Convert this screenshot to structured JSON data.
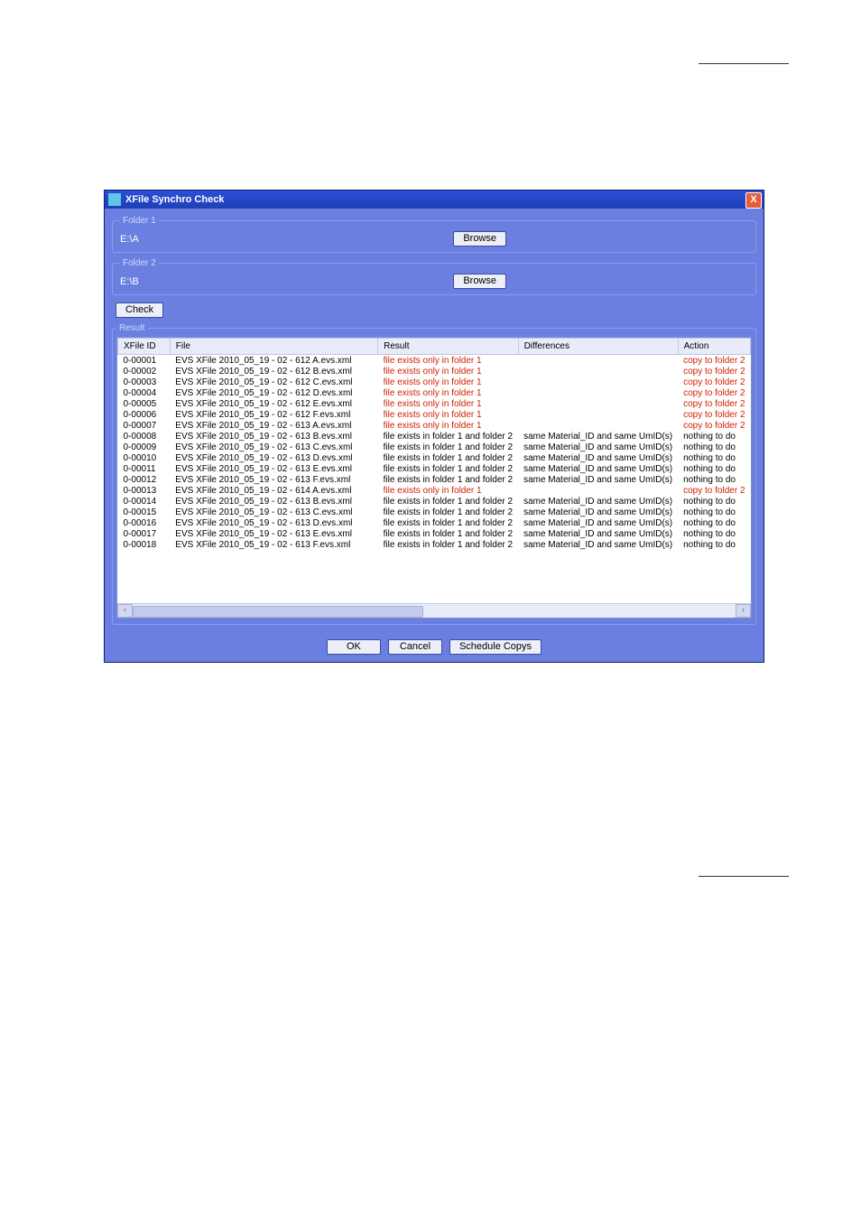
{
  "window": {
    "title": "XFile Synchro Check",
    "close": "X"
  },
  "folder1": {
    "legend": "Folder 1",
    "path": "E:\\A",
    "browse": "Browse"
  },
  "folder2": {
    "legend": "Folder 2",
    "path": "E:\\B",
    "browse": "Browse"
  },
  "check_btn": "Check",
  "result_legend": "Result",
  "columns": {
    "xfileid": "XFile ID",
    "file": "File",
    "result": "Result",
    "differences": "Differences",
    "action": "Action"
  },
  "rows": [
    {
      "id": "0-00001",
      "file": "EVS XFile 2010_05_19 - 02 - 612 A.evs.xml",
      "result": "file exists only in folder 1",
      "diff": "",
      "action": "copy to folder 2",
      "red": true
    },
    {
      "id": "0-00002",
      "file": "EVS XFile 2010_05_19 - 02 - 612 B.evs.xml",
      "result": "file exists only in folder 1",
      "diff": "",
      "action": "copy to folder 2",
      "red": true
    },
    {
      "id": "0-00003",
      "file": "EVS XFile 2010_05_19 - 02 - 612 C.evs.xml",
      "result": "file exists only in folder 1",
      "diff": "",
      "action": "copy to folder 2",
      "red": true
    },
    {
      "id": "0-00004",
      "file": "EVS XFile 2010_05_19 - 02 - 612 D.evs.xml",
      "result": "file exists only in folder 1",
      "diff": "",
      "action": "copy to folder 2",
      "red": true
    },
    {
      "id": "0-00005",
      "file": "EVS XFile 2010_05_19 - 02 - 612 E.evs.xml",
      "result": "file exists only in folder 1",
      "diff": "",
      "action": "copy to folder 2",
      "red": true
    },
    {
      "id": "0-00006",
      "file": "EVS XFile 2010_05_19 - 02 - 612 F.evs.xml",
      "result": "file exists only in folder 1",
      "diff": "",
      "action": "copy to folder 2",
      "red": true
    },
    {
      "id": "0-00007",
      "file": "EVS XFile 2010_05_19 - 02 - 613 A.evs.xml",
      "result": "file exists only in folder 1",
      "diff": "",
      "action": "copy to folder 2",
      "red": true
    },
    {
      "id": "0-00008",
      "file": "EVS XFile 2010_05_19 - 02 - 613 B.evs.xml",
      "result": "file exists in folder 1 and folder 2",
      "diff": "same Material_ID and same UmID(s)",
      "action": "nothing to do",
      "red": false
    },
    {
      "id": "0-00009",
      "file": "EVS XFile 2010_05_19 - 02 - 613 C.evs.xml",
      "result": "file exists in folder 1 and folder 2",
      "diff": "same Material_ID and same UmID(s)",
      "action": "nothing to do",
      "red": false
    },
    {
      "id": "0-00010",
      "file": "EVS XFile 2010_05_19 - 02 - 613 D.evs.xml",
      "result": "file exists in folder 1 and folder 2",
      "diff": "same Material_ID and same UmID(s)",
      "action": "nothing to do",
      "red": false
    },
    {
      "id": "0-00011",
      "file": "EVS XFile 2010_05_19 - 02 - 613 E.evs.xml",
      "result": "file exists in folder 1 and folder 2",
      "diff": "same Material_ID and same UmID(s)",
      "action": "nothing to do",
      "red": false
    },
    {
      "id": "0-00012",
      "file": "EVS XFile 2010_05_19 - 02 - 613 F.evs.xml",
      "result": "file exists in folder 1 and folder 2",
      "diff": "same Material_ID and same UmID(s)",
      "action": "nothing to do",
      "red": false
    },
    {
      "id": "0-00013",
      "file": "EVS XFile 2010_05_19 - 02 - 614 A.evs.xml",
      "result": "file exists only in folder 1",
      "diff": "",
      "action": "copy to folder 2",
      "red": true
    },
    {
      "id": "0-00014",
      "file": "EVS XFile 2010_05_19 - 02 - 613 B.evs.xml",
      "result": "file exists in folder 1 and folder 2",
      "diff": "same Material_ID and same UmID(s)",
      "action": "nothing to do",
      "red": false
    },
    {
      "id": "0-00015",
      "file": "EVS XFile 2010_05_19 - 02 - 613 C.evs.xml",
      "result": "file exists in folder 1 and folder 2",
      "diff": "same Material_ID and same UmID(s)",
      "action": "nothing to do",
      "red": false
    },
    {
      "id": "0-00016",
      "file": "EVS XFile 2010_05_19 - 02 - 613 D.evs.xml",
      "result": "file exists in folder 1 and folder 2",
      "diff": "same Material_ID and same UmID(s)",
      "action": "nothing to do",
      "red": false
    },
    {
      "id": "0-00017",
      "file": "EVS XFile 2010_05_19 - 02 - 613 E.evs.xml",
      "result": "file exists in folder 1 and folder 2",
      "diff": "same Material_ID and same UmID(s)",
      "action": "nothing to do",
      "red": false
    },
    {
      "id": "0-00018",
      "file": "EVS XFile 2010_05_19 - 02 - 613 F.evs.xml",
      "result": "file exists in folder 1 and folder 2",
      "diff": "same Material_ID and same UmID(s)",
      "action": "nothing to do",
      "red": false
    }
  ],
  "footer": {
    "ok": "OK",
    "cancel": "Cancel",
    "schedule": "Schedule Copys"
  }
}
